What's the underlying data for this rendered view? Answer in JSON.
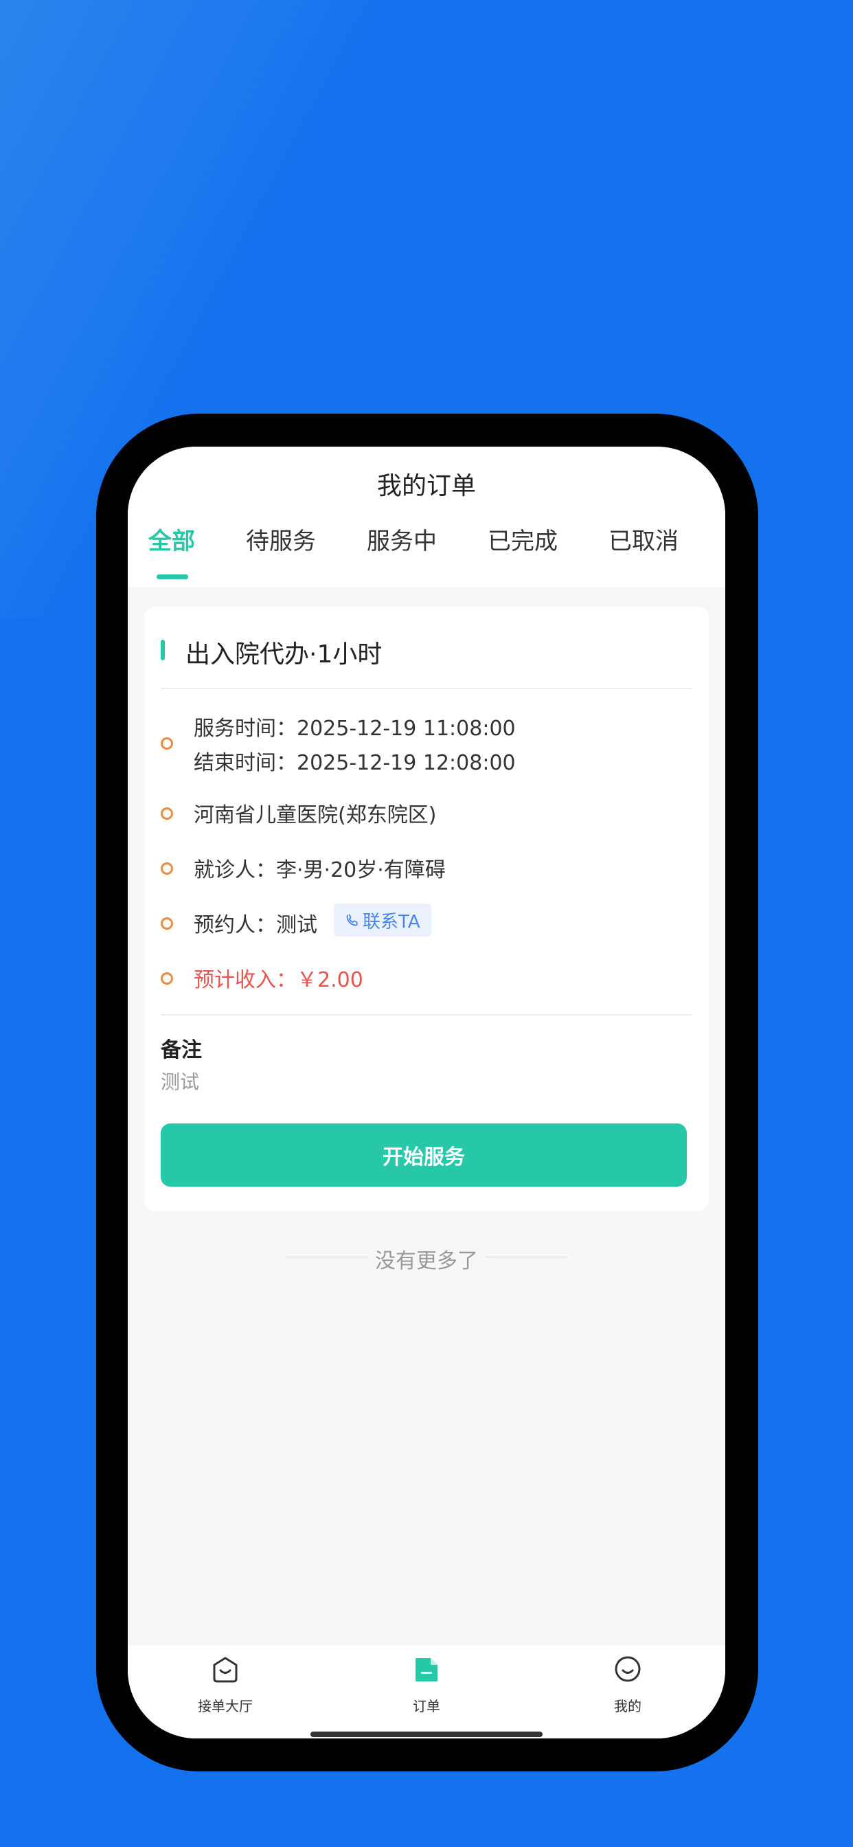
{
  "header": {
    "title": "我的订单"
  },
  "tabs": [
    {
      "label": "全部",
      "active": true
    },
    {
      "label": "待服务",
      "active": false
    },
    {
      "label": "服务中",
      "active": false
    },
    {
      "label": "已完成",
      "active": false
    },
    {
      "label": "已取消",
      "active": false
    }
  ],
  "order": {
    "service_name": "出入院代办·1小时",
    "service_time_label": "服务时间：",
    "service_time": "2025-12-19 11:08:00",
    "end_time_label": "结束时间：",
    "end_time": "2025-12-19 12:08:00",
    "hospital": "河南省儿童医院(郑东院区)",
    "patient_label": "就诊人：",
    "patient": "李·男·20岁·有障碍",
    "booker_label": "预约人：",
    "booker": "测试",
    "contact_label": "联系TA",
    "income_label": "预计收入：",
    "income": "￥2.00",
    "remark_label": "备注",
    "remark": "测试",
    "start_button": "开始服务"
  },
  "list_footer": "没有更多了",
  "tabbar": [
    {
      "label": "接单大厅",
      "icon": "hall-icon"
    },
    {
      "label": "订单",
      "icon": "order-icon",
      "active": true
    },
    {
      "label": "我的",
      "icon": "profile-icon"
    }
  ],
  "colors": {
    "background": "#1572ee",
    "accent": "#27c8a8",
    "income": "#e8544f",
    "dot": "#ef8a3a",
    "contact": "#4a86e8"
  }
}
